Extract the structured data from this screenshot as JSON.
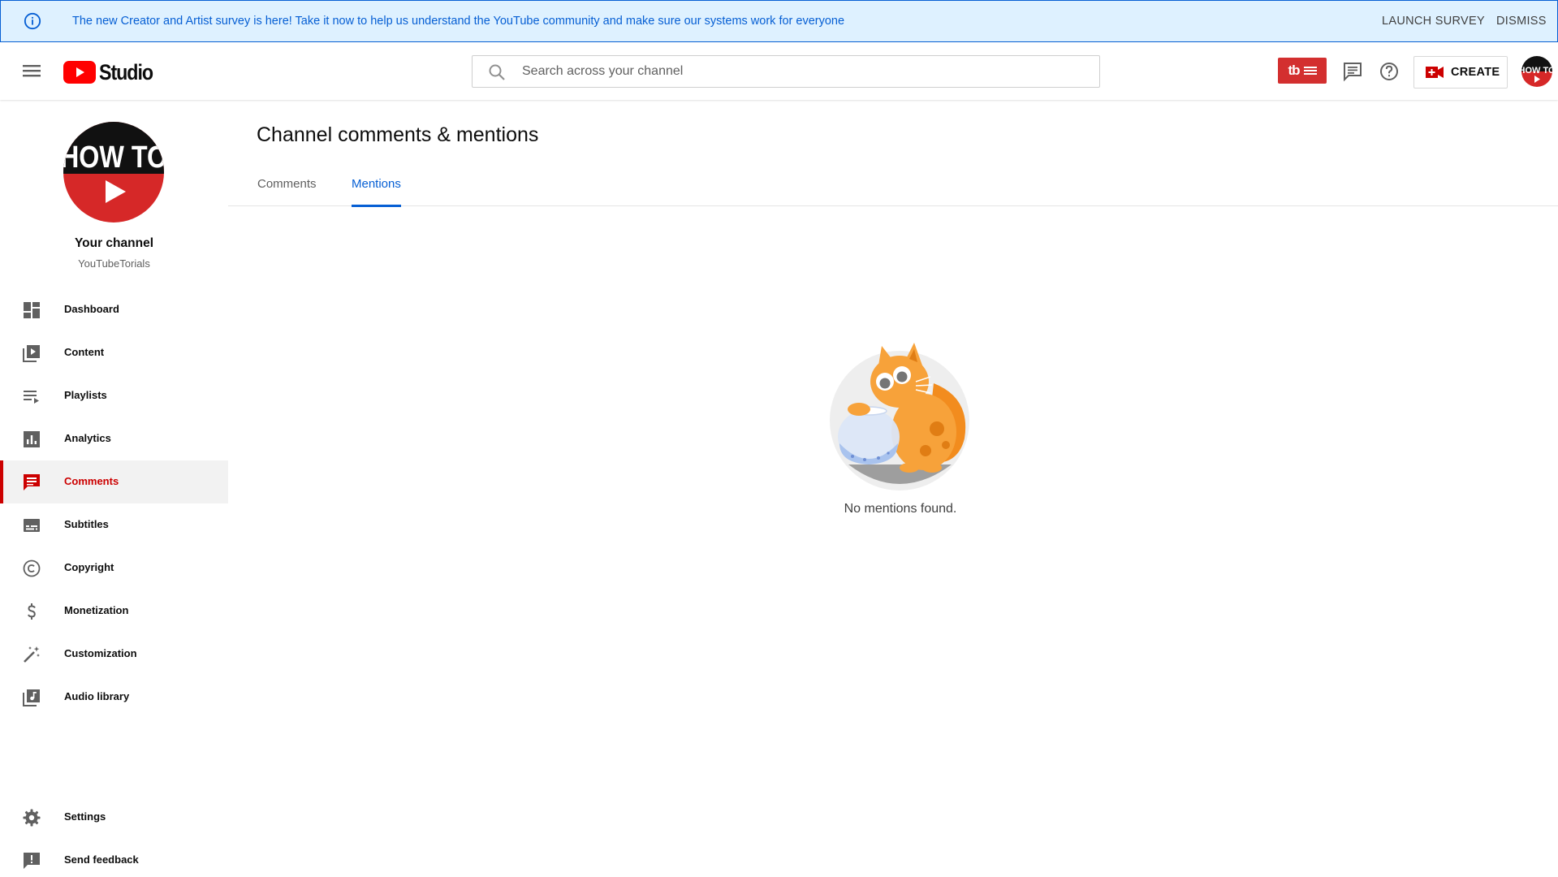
{
  "banner": {
    "message": "The new Creator and Artist survey is here! Take it now to help us understand the YouTube community and make sure our systems work for everyone",
    "launch_label": "LAUNCH SURVEY",
    "dismiss_label": "DISMISS"
  },
  "header": {
    "logo_text": "Studio",
    "search_placeholder": "Search across your channel",
    "extension_badge": "tb",
    "create_label": "CREATE"
  },
  "channel": {
    "title": "Your channel",
    "name": "YouTubeTorials",
    "avatar_text": "HOW TO"
  },
  "sidebar": {
    "items": [
      {
        "label": "Dashboard",
        "icon": "dashboard-icon"
      },
      {
        "label": "Content",
        "icon": "content-icon"
      },
      {
        "label": "Playlists",
        "icon": "playlists-icon"
      },
      {
        "label": "Analytics",
        "icon": "analytics-icon"
      },
      {
        "label": "Comments",
        "icon": "comments-icon",
        "active": true
      },
      {
        "label": "Subtitles",
        "icon": "subtitles-icon"
      },
      {
        "label": "Copyright",
        "icon": "copyright-icon"
      },
      {
        "label": "Monetization",
        "icon": "monetization-icon"
      },
      {
        "label": "Customization",
        "icon": "customization-icon"
      },
      {
        "label": "Audio library",
        "icon": "audio-library-icon"
      }
    ],
    "bottom": [
      {
        "label": "Settings",
        "icon": "settings-icon"
      },
      {
        "label": "Send feedback",
        "icon": "feedback-icon"
      }
    ]
  },
  "main": {
    "title": "Channel comments & mentions",
    "tabs": [
      {
        "label": "Comments",
        "active": false
      },
      {
        "label": "Mentions",
        "active": true
      }
    ],
    "empty_message": "No mentions found."
  },
  "colors": {
    "accent_red": "#cc0000",
    "link_blue": "#065fd4",
    "banner_bg": "#def1ff"
  }
}
